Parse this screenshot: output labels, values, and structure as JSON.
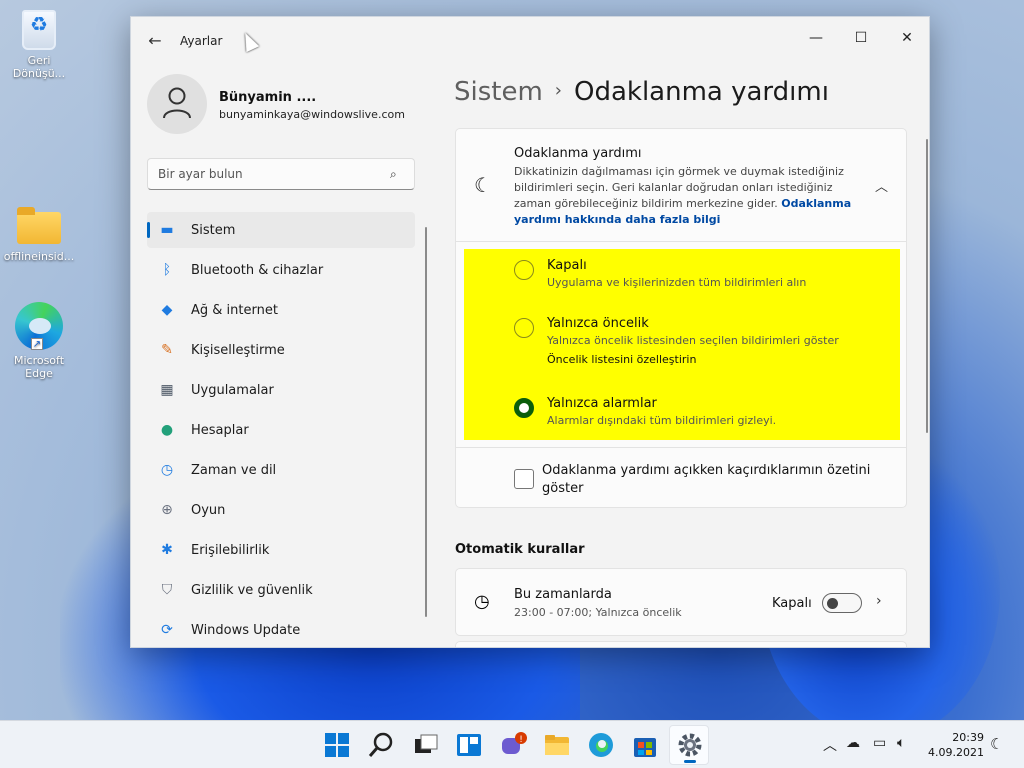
{
  "desktop": {
    "icons": [
      {
        "label": "Geri Dönüşü..."
      },
      {
        "label": "offlineinsid..."
      },
      {
        "label": "Microsoft Edge"
      }
    ]
  },
  "window": {
    "app_title": "Ayarlar",
    "controls": {
      "minimize": "—",
      "maximize": "☐",
      "close": "✕"
    }
  },
  "profile": {
    "name": "Bünyamin ....",
    "email": "bunyaminkaya@windowslive.com"
  },
  "search": {
    "placeholder": "Bir ayar bulun"
  },
  "nav": {
    "items": [
      {
        "label": "Sistem",
        "icon": "display-icon",
        "glyph": "▬",
        "color": "#1f7be0",
        "active": true
      },
      {
        "label": "Bluetooth & cihazlar",
        "icon": "bluetooth-icon",
        "glyph": "ᛒ",
        "color": "#1f7be0"
      },
      {
        "label": "Ağ & internet",
        "icon": "wifi-icon",
        "glyph": "◆",
        "color": "#1f7be0"
      },
      {
        "label": "Kişiselleştirme",
        "icon": "brush-icon",
        "glyph": "✎",
        "color": "#d86f1f"
      },
      {
        "label": "Uygulamalar",
        "icon": "apps-icon",
        "glyph": "▦",
        "color": "#4a5563"
      },
      {
        "label": "Hesaplar",
        "icon": "person-icon",
        "glyph": "●",
        "color": "#22a07a"
      },
      {
        "label": "Zaman ve dil",
        "icon": "globe-clock-icon",
        "glyph": "◷",
        "color": "#1f7be0"
      },
      {
        "label": "Oyun",
        "icon": "gamepad-icon",
        "glyph": "⊕",
        "color": "#6b7280"
      },
      {
        "label": "Erişilebilirlik",
        "icon": "accessibility-icon",
        "glyph": "✱",
        "color": "#1f7be0"
      },
      {
        "label": "Gizlilik ve güvenlik",
        "icon": "shield-icon",
        "glyph": "⛉",
        "color": "#6b7280"
      },
      {
        "label": "Windows Update",
        "icon": "update-icon",
        "glyph": "⟳",
        "color": "#1f7be0"
      }
    ]
  },
  "breadcrumb": {
    "parent": "Sistem",
    "separator": "›",
    "current": "Odaklanma yardımı"
  },
  "focus_card": {
    "title": "Odaklanma yardımı",
    "description": "Dikkatinizin dağılmaması için görmek ve duymak istediğiniz bildirimleri seçin. Geri kalanlar doğrudan onları istediğiniz zaman görebileceğiniz bildirim merkezine gider.",
    "learn_more": "Odaklanma yardımı hakkında daha fazla bilgi",
    "options": [
      {
        "title": "Kapalı",
        "subtitle": "Uygulama ve kişilerinizden tüm bildirimleri alın",
        "checked": false
      },
      {
        "title": "Yalnızca öncelik",
        "subtitle": "Yalnızca öncelik listesinden seçilen bildirimleri göster",
        "link": "Öncelik listesini özelleştirin",
        "checked": false
      },
      {
        "title": "Yalnızca alarmlar",
        "subtitle": "Alarmlar dışındaki tüm bildirimleri gizleyi.",
        "checked": true
      }
    ],
    "summary_checkbox": "Odaklanma yardımı açıkken kaçırdıklarımın özetini göster",
    "highlight_color": "#ffff00"
  },
  "auto_rules": {
    "title": "Otomatik kurallar",
    "rules": [
      {
        "title": "Bu zamanlarda",
        "subtitle": "23:00 - 07:00; Yalnızca öncelik",
        "state": "Kapalı"
      }
    ]
  },
  "taskbar": {
    "time": "20:39",
    "date": "4.09.2021",
    "accent": "#0067c0"
  }
}
